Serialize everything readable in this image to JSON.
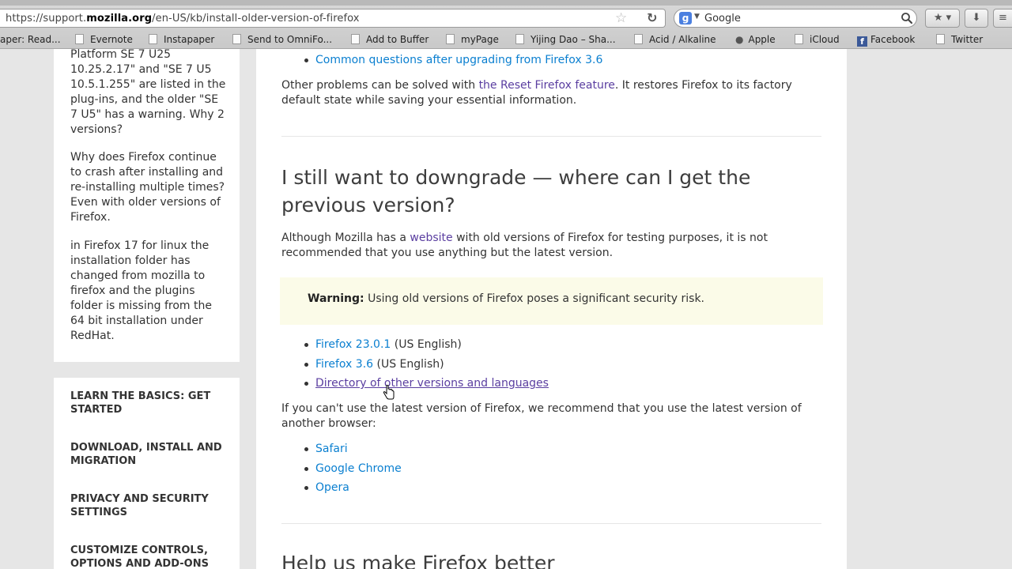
{
  "browser": {
    "url_prefix": "https://support.",
    "url_domain": "mozilla.org",
    "url_path": "/en-US/kb/install-older-version-of-firefox",
    "search_engine": "Google",
    "bookmarks": [
      "aper: Read...",
      "Evernote",
      "Instapaper",
      "Send to OmniFo...",
      "Add to Buffer",
      "myPage",
      "Yijing Dao – Sha...",
      "Acid / Alkaline",
      "Apple",
      "iCloud",
      "Facebook",
      "Twitter"
    ]
  },
  "sidebar": {
    "related": [
      "Platform SE 7 U25 10.25.2.17\" and \"SE 7 U5 10.5.1.255\" are listed in the plug-ins, and the older \"SE 7 U5\" has a warning. Why 2 versions?",
      "Why does Firefox continue to crash after installing and re-installing multiple times? Even with older versions of Firefox.",
      "in Firefox 17 for linux the installation folder has changed from mozilla to firefox and the plugins folder is missing from the 64 bit installation under RedHat."
    ],
    "nav": [
      "LEARN THE BASICS: GET STARTED",
      "DOWNLOAD, INSTALL AND MIGRATION",
      "PRIVACY AND SECURITY SETTINGS",
      "CUSTOMIZE CONTROLS, OPTIONS AND ADD-ONS"
    ]
  },
  "article": {
    "top_link": "Common questions after upgrading from Firefox 3.6",
    "reset_pre": "Other problems can be solved with ",
    "reset_link": "the Reset Firefox feature",
    "reset_post": ". It restores Firefox to its factory default state while saving your essential information.",
    "downgrade_heading": "I still want to downgrade — where can I get the previous version?",
    "website_pre": "Although Mozilla has a ",
    "website_link": "website",
    "website_post": " with old versions of Firefox for testing purposes, it is not recommended that you use anything but the latest version.",
    "warning_label": "Warning:",
    "warning_text": " Using old versions of Firefox poses a significant security risk.",
    "versions": [
      {
        "link": "Firefox 23.0.1",
        "note": " (US English)"
      },
      {
        "link": "Firefox 3.6",
        "note": " (US English)"
      },
      {
        "link": "Directory of other versions and languages",
        "note": ""
      }
    ],
    "browser_para": "If you can't use the latest version of Firefox, we recommend that you use the latest version of another browser:",
    "browsers": [
      "Safari",
      "Google Chrome",
      "Opera"
    ],
    "next_heading": "Help us make Firefox better"
  },
  "colors": {
    "link": "#0a7fd0",
    "visited": "#5a3ea0",
    "warning_bg": "#fbfbe8"
  },
  "icons": [
    "star-icon",
    "reload-icon",
    "search-icon",
    "bookmarks-icon",
    "download-icon",
    "menu-icon",
    "facebook-icon",
    "apple-icon",
    "cursor-icon"
  ]
}
